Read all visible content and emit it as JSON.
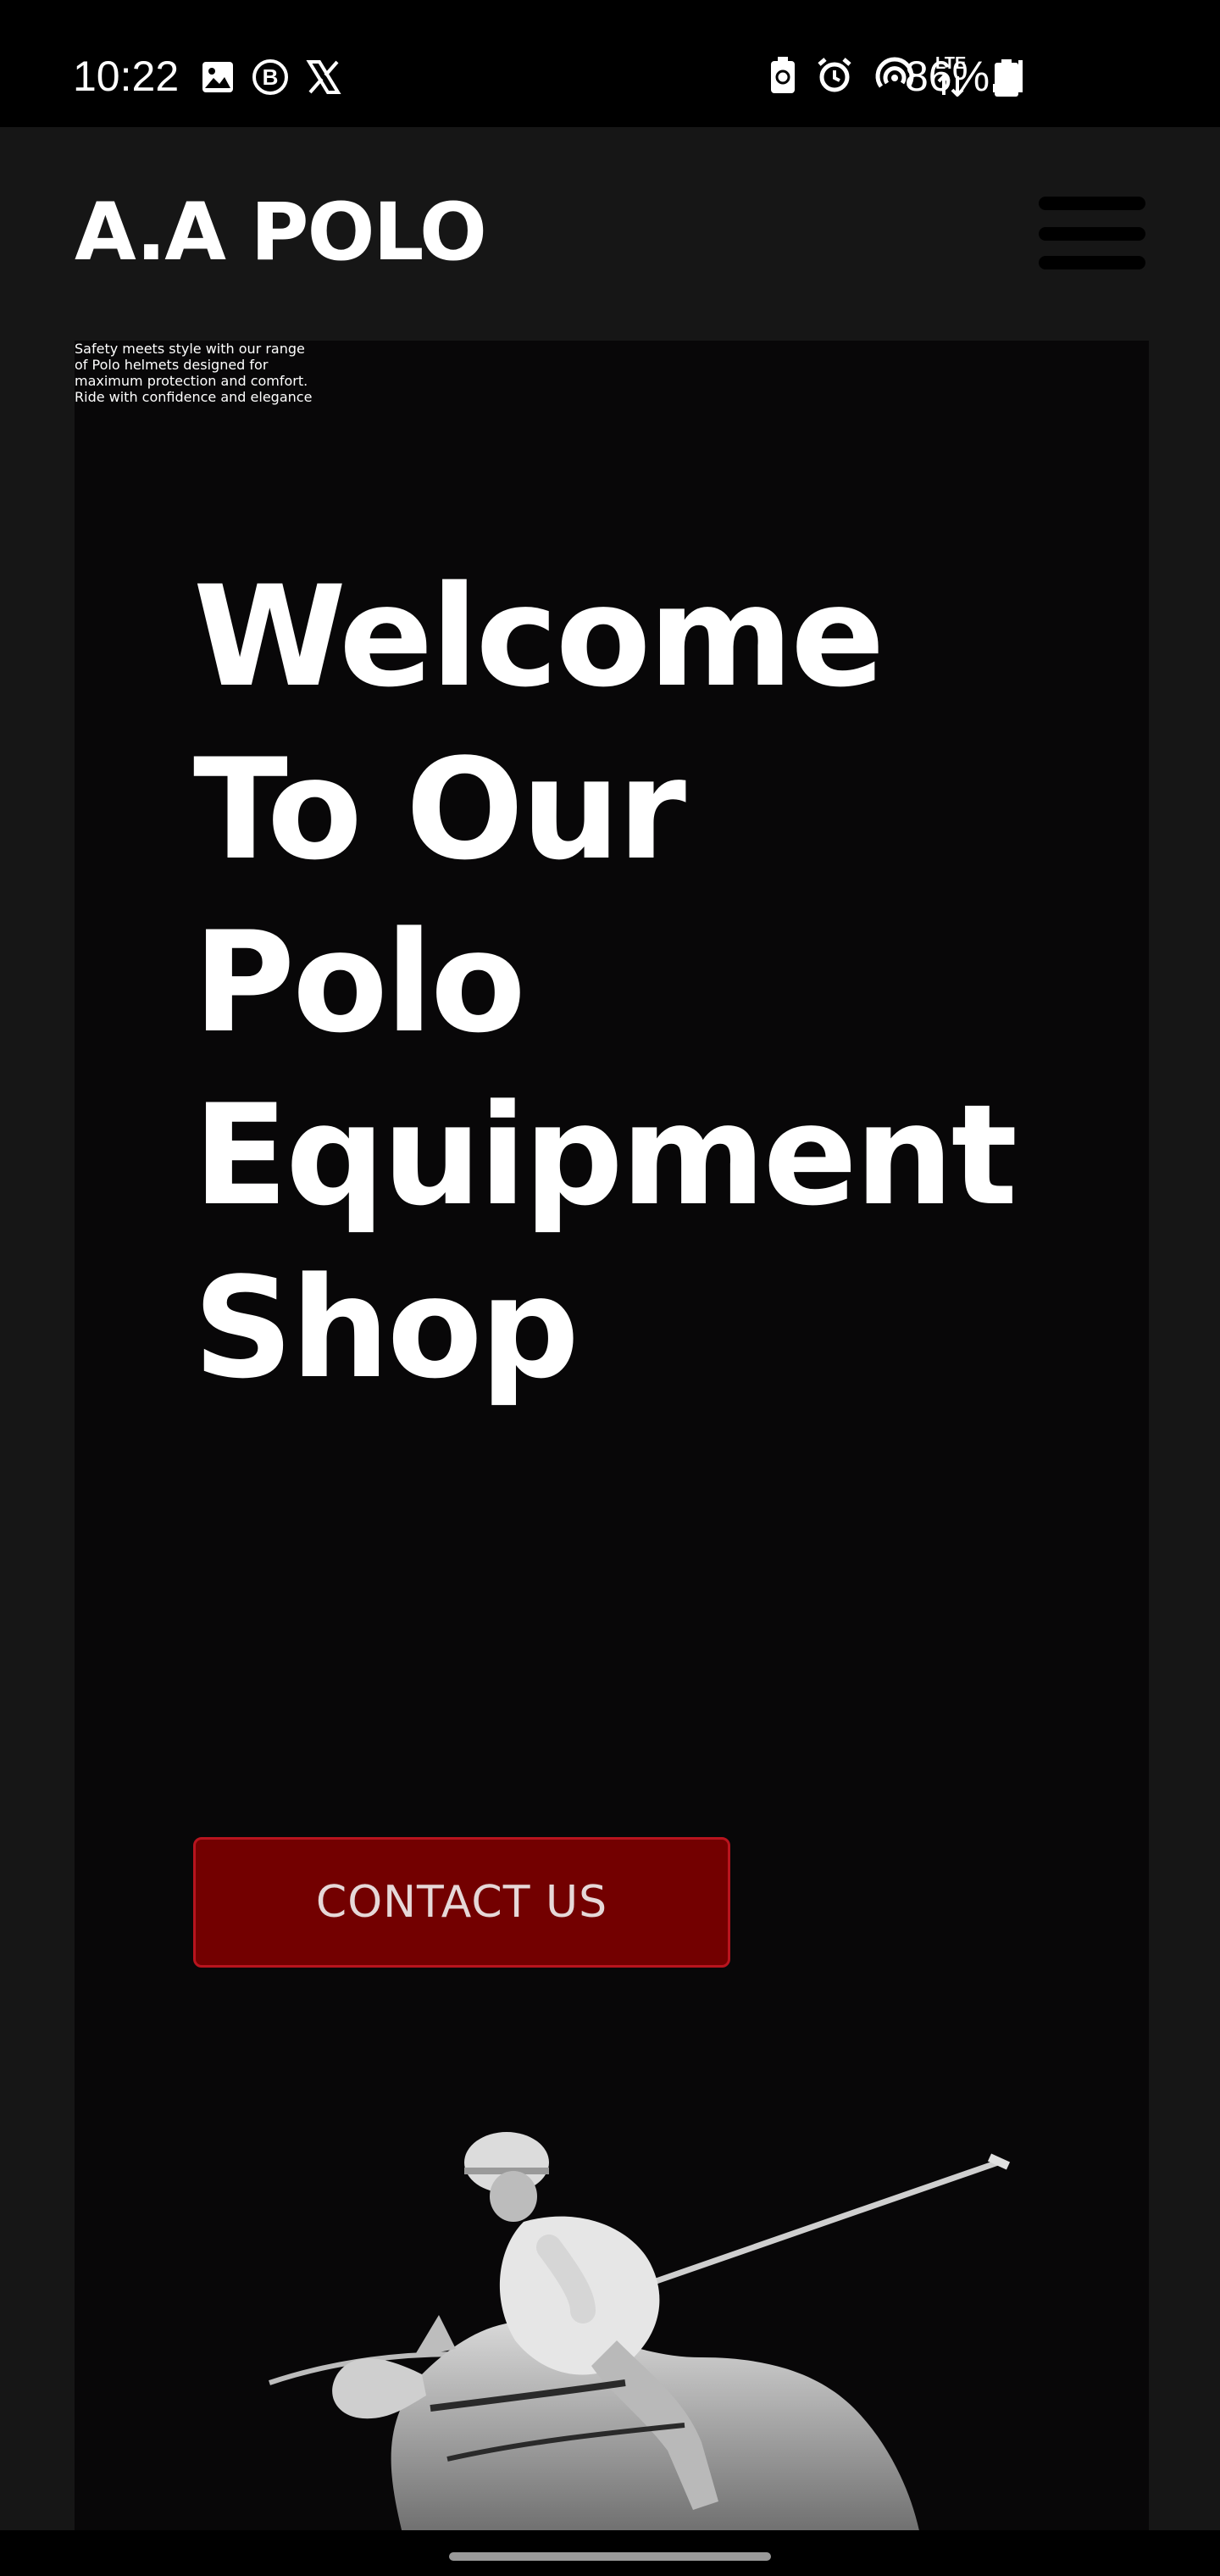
{
  "status_bar": {
    "time": "10:22",
    "left_icons": [
      "image-icon",
      "b-circle-icon",
      "x-logo-icon"
    ],
    "right_icons": [
      "recycle-battery-icon",
      "alarm-icon",
      "hotspot-icon",
      "lte-icon",
      "signal-icon"
    ],
    "lte_label": "LTE",
    "battery_percent": "86%"
  },
  "header": {
    "logo": "A.A POLO",
    "menu_icon": "hamburger-menu-icon"
  },
  "hero": {
    "title_lines": [
      "Welcome",
      "To Our",
      "Polo",
      "Equipment",
      "Shop"
    ],
    "text_lines": [
      "Safety meets style with our range",
      "of Polo helmets designed for",
      "maximum protection and comfort.",
      "Ride with confidence and elegance"
    ],
    "cta_label": "CONTACT US",
    "image_alt_icon": "polo-player-on-horse-image"
  },
  "colors": {
    "header_bg": "#161616",
    "hero_bg": "#080708",
    "cta_bg": "#730000",
    "cta_border": "#b8141e",
    "text": "#ffffff"
  }
}
